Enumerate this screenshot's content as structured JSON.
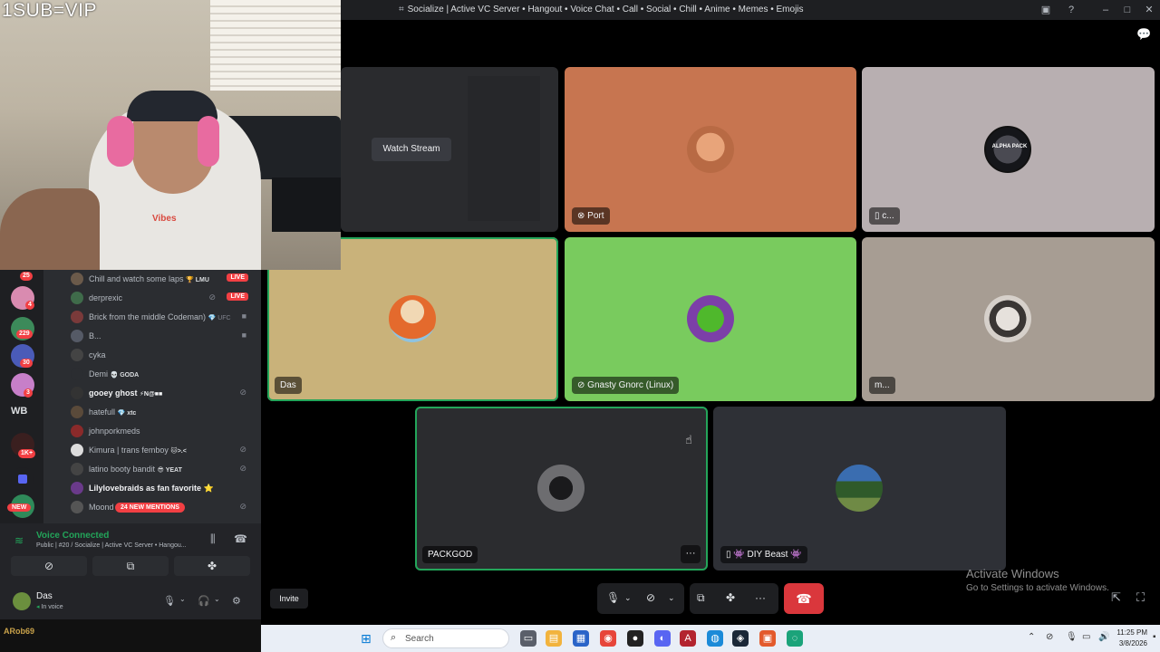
{
  "window": {
    "title": "Socialize | Active VC Server • Hangout • Voice Chat • Call • Social • Chill • Anime • Memes • Emojis",
    "hash_icon": "hash-icon"
  },
  "webcam": {
    "overlay_label": "1SUB=VIP",
    "shirt_text": "Vibes"
  },
  "rail": {
    "badges": [
      "25",
      "4",
      "229",
      "30",
      "3",
      "1K+"
    ],
    "wb_label": "WB",
    "new_label": "NEW"
  },
  "members": [
    {
      "name": "Chill and watch some laps",
      "tag": "🏆 LMU",
      "live": "LIVE"
    },
    {
      "name": "derprexic",
      "tag": "",
      "live": "LIVE"
    },
    {
      "name": "Brick from the middle Codeman)",
      "tag": "💎 UFC",
      "live": ""
    },
    {
      "name": "B...",
      "tag": "",
      "live": ""
    },
    {
      "name": "cyka",
      "tag": "",
      "live": ""
    },
    {
      "name": "Demi",
      "tag": "💀 GODA",
      "live": ""
    },
    {
      "name": "gooey ghost",
      "tag": "⚡N@■■",
      "live": ""
    },
    {
      "name": "hatefull",
      "tag": "💎 xtc",
      "live": ""
    },
    {
      "name": "johnporkmeds",
      "tag": "",
      "live": ""
    },
    {
      "name": "Kimura | trans femboy",
      "tag": "🐱>.<",
      "live": ""
    },
    {
      "name": "latino booty bandit",
      "tag": "😎 YEAT",
      "live": ""
    },
    {
      "name": "Lilylovebraids as fan favorite",
      "tag": "⭐",
      "live": ""
    },
    {
      "name": "Moond",
      "tag": "",
      "live": ""
    }
  ],
  "mentions_pill": "24 NEW MENTIONS",
  "voice": {
    "status": "Voice Connected",
    "channel": "Public | #20 / Socialize | Active VC Server • Hangou..."
  },
  "user": {
    "name": "Das",
    "status": "In voice"
  },
  "streamer_name": "ARob69",
  "tiles": {
    "watch_stream": "Watch Stream",
    "port": "Port",
    "c": "c...",
    "das": "Das",
    "gnasty": "Gnasty Gnorc (Linux)",
    "m": "m...",
    "packgod": "PACKGOD",
    "diy": "👾 DIY Beast 👾",
    "alpha_pack": "ALPHA PACK"
  },
  "controls": {
    "invite": "Invite"
  },
  "activate_windows": {
    "line1": "Activate Windows",
    "line2": "Go to Settings to activate Windows."
  },
  "taskbar": {
    "search_placeholder": "Search",
    "time": "11:25 PM",
    "date": "3/8/2026"
  },
  "colors": {
    "speaking_ring": "#23a55a",
    "hangup": "#da373c",
    "live_badge": "#f23f43",
    "tile_port": "#c77550",
    "tile_das": "#c9b27a",
    "tile_gnasty": "#79cb5e",
    "tile_m": "#a79d93",
    "tile_c": "#b8afb1"
  }
}
